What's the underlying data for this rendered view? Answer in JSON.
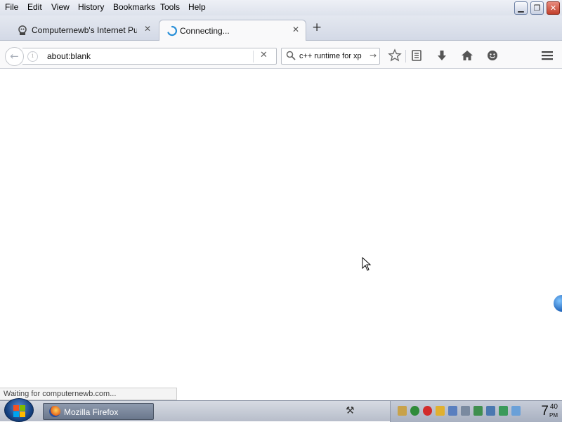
{
  "menubar": {
    "items": [
      "File",
      "Edit",
      "View",
      "History",
      "Bookmarks",
      "Tools",
      "Help"
    ]
  },
  "window_controls": {
    "minimize": "▁",
    "restore": "❐",
    "close": "✕"
  },
  "tabs": [
    {
      "title": "Computernewb's Internet Pu...",
      "icon": "site-favicon-icon",
      "close": "✕"
    },
    {
      "title": "Connecting...",
      "icon": "loading-spinner-icon",
      "close": "✕"
    }
  ],
  "new_tab": "+",
  "navbar": {
    "back": "←",
    "url": "about:blank",
    "stop": "✕",
    "search_value": "c++ runtime for xp",
    "search_go": "→",
    "icons": [
      "bookmark-star-icon",
      "reading-list-icon",
      "downloads-icon",
      "home-icon",
      "sync-face-icon",
      "hamburger-menu-icon"
    ]
  },
  "status": {
    "text": "Waiting for computernewb.com..."
  },
  "taskbar": {
    "task_label": "Mozilla Firefox",
    "clock_hour": "7",
    "clock_minute": "40",
    "clock_ampm": "PM"
  }
}
